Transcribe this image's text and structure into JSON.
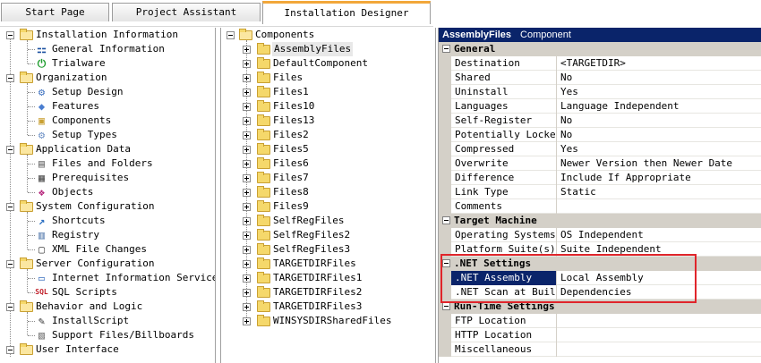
{
  "tabs": [
    {
      "label": "Start Page"
    },
    {
      "label": "Project Assistant"
    },
    {
      "label": "Installation Designer"
    }
  ],
  "left_tree": {
    "groups": [
      {
        "label": "Installation Information",
        "items": [
          "General Information",
          "Trialware"
        ]
      },
      {
        "label": "Organization",
        "items": [
          "Setup Design",
          "Features",
          "Components",
          "Setup Types"
        ]
      },
      {
        "label": "Application Data",
        "items": [
          "Files and Folders",
          "Prerequisites",
          "Objects"
        ]
      },
      {
        "label": "System Configuration",
        "items": [
          "Shortcuts",
          "Registry",
          "XML File Changes"
        ]
      },
      {
        "label": "Server Configuration",
        "items": [
          "Internet Information Services",
          "SQL Scripts"
        ]
      },
      {
        "label": "Behavior and Logic",
        "items": [
          "InstallScript",
          "Support Files/Billboards"
        ]
      },
      {
        "label": "User Interface",
        "items": []
      }
    ]
  },
  "mid_tree": {
    "root": "Components",
    "items": [
      "AssemblyFiles",
      "DefaultComponent",
      "Files",
      "Files1",
      "Files10",
      "Files13",
      "Files2",
      "Files5",
      "Files6",
      "Files7",
      "Files8",
      "Files9",
      "SelfRegFiles",
      "SelfRegFiles2",
      "SelfRegFiles3",
      "TARGETDIRFiles",
      "TARGETDIRFiles1",
      "TARGETDIRFiles2",
      "TARGETDIRFiles3",
      "WINSYSDIRSharedFiles"
    ]
  },
  "property_grid": {
    "title": "AssemblyFiles",
    "subtitle": "Component",
    "categories": [
      {
        "name": "General",
        "rows": [
          {
            "name": "Destination",
            "value": "<TARGETDIR>"
          },
          {
            "name": "Shared",
            "value": "No"
          },
          {
            "name": "Uninstall",
            "value": "Yes"
          },
          {
            "name": "Languages",
            "value": "Language Independent"
          },
          {
            "name": "Self-Register",
            "value": "No"
          },
          {
            "name": "Potentially Locked",
            "value": "No"
          },
          {
            "name": "Compressed",
            "value": "Yes"
          },
          {
            "name": "Overwrite",
            "value": "Newer Version then Newer Date"
          },
          {
            "name": "Difference",
            "value": "Include If Appropriate"
          },
          {
            "name": "Link Type",
            "value": "Static"
          },
          {
            "name": "Comments",
            "value": ""
          }
        ]
      },
      {
        "name": "Target Machine",
        "rows": [
          {
            "name": "Operating Systems",
            "value": "OS Independent"
          },
          {
            "name": "Platform Suite(s)",
            "value": "Suite Independent"
          }
        ]
      },
      {
        "name": ".NET Settings",
        "rows": [
          {
            "name": ".NET Assembly",
            "value": "Local Assembly"
          },
          {
            "name": ".NET Scan at Build",
            "value": "Dependencies"
          }
        ]
      },
      {
        "name": "Run-Time Settings",
        "rows": [
          {
            "name": "FTP Location",
            "value": ""
          },
          {
            "name": "HTTP Location",
            "value": ""
          },
          {
            "name": "Miscellaneous",
            "value": ""
          }
        ]
      }
    ],
    "selected_row": ".NET Assembly"
  },
  "colors": {
    "accent_tab": "#f2a73a",
    "selection": "#0a246a",
    "highlight_box": "#e0252b"
  }
}
